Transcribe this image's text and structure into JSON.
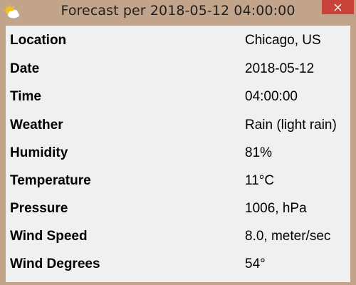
{
  "window": {
    "title": "Forecast per 2018-05-12 04:00:00",
    "icon": "weather-app-icon",
    "close_icon": "close-icon",
    "close_button_color": "#c8433a",
    "titlebar_color": "#c2a48a"
  },
  "rows": [
    {
      "label": "Location",
      "value": "Chicago, US"
    },
    {
      "label": "Date",
      "value": "2018-05-12"
    },
    {
      "label": "Time",
      "value": "04:00:00"
    },
    {
      "label": "Weather",
      "value": "Rain (light rain)"
    },
    {
      "label": "Humidity",
      "value": "81%"
    },
    {
      "label": "Temperature",
      "value": "11°C"
    },
    {
      "label": "Pressure",
      "value": "1006, hPa"
    },
    {
      "label": "Wind Speed",
      "value": "8.0, meter/sec"
    },
    {
      "label": "Wind Degrees",
      "value": "54°"
    }
  ]
}
